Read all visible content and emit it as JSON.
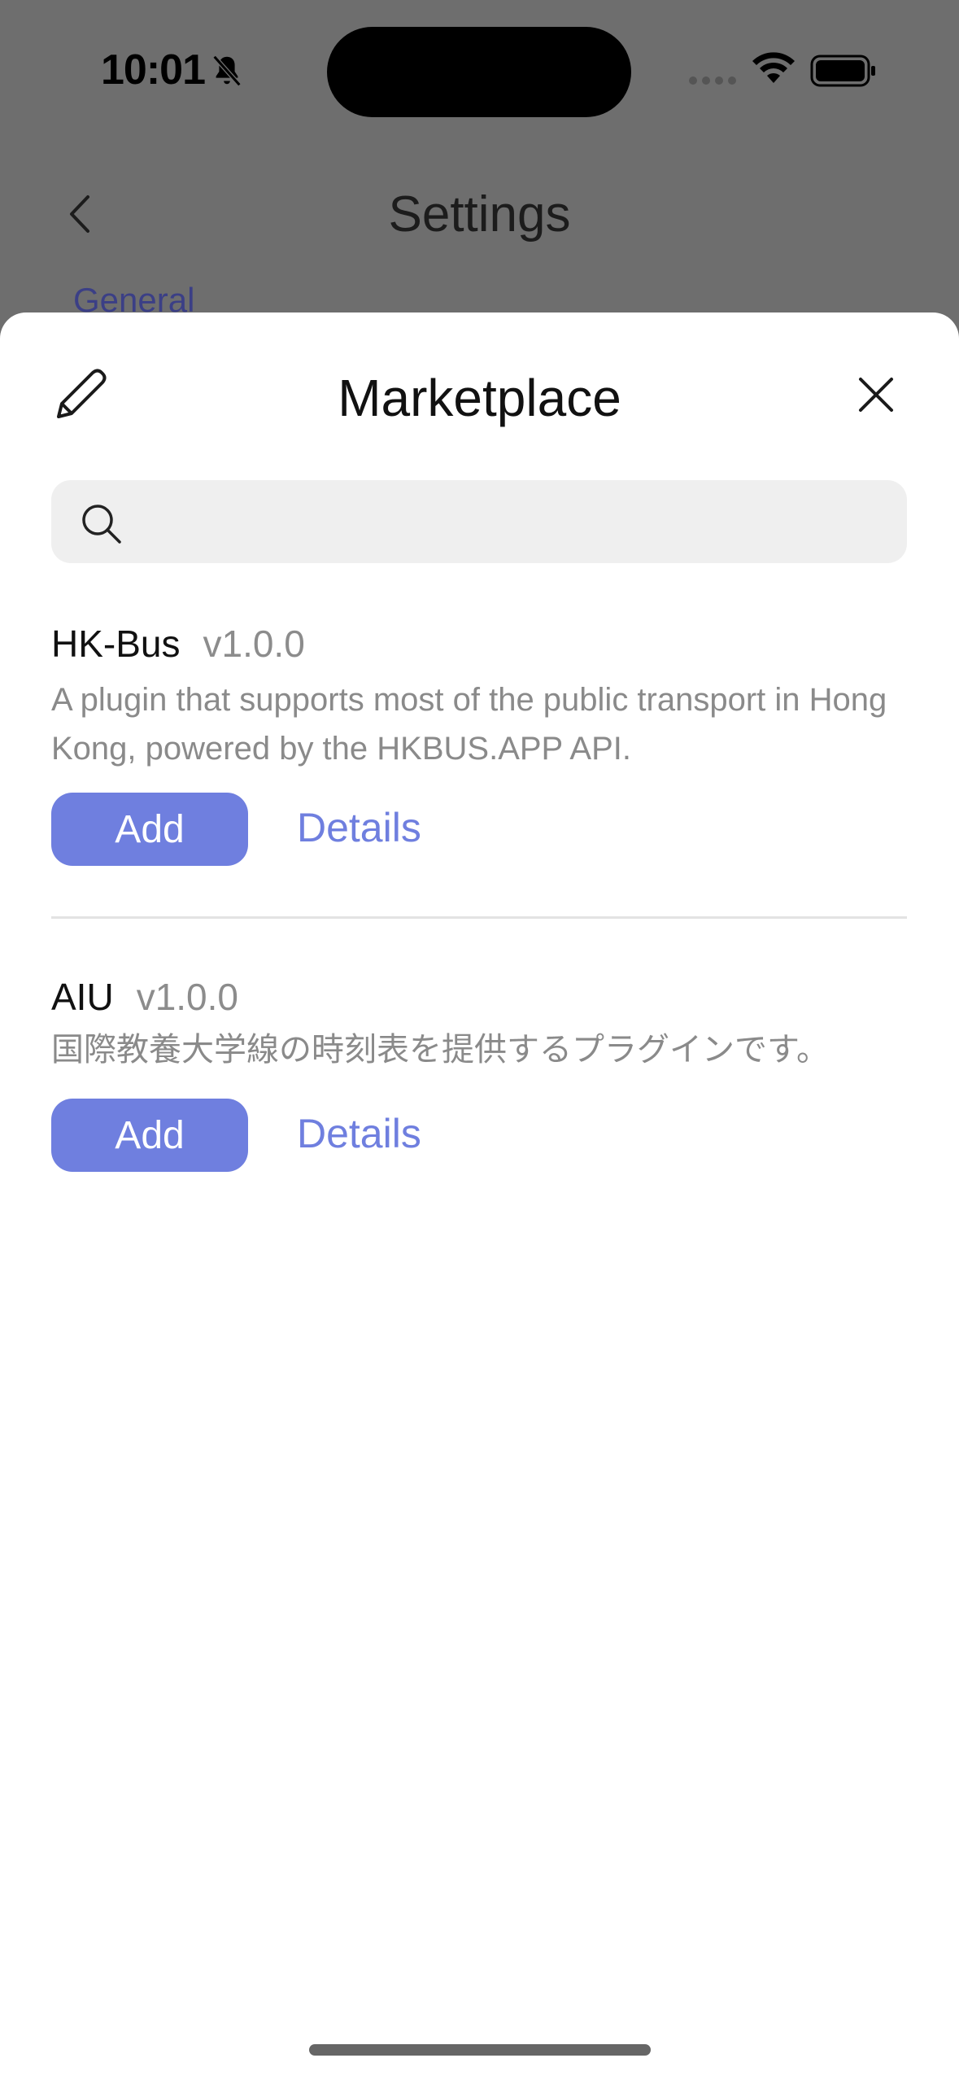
{
  "status_bar": {
    "time": "10:01",
    "icons": [
      "bell-off-icon",
      "signal-icon",
      "wifi-icon",
      "battery-icon"
    ]
  },
  "background_screen": {
    "title": "Settings",
    "section_label": "General"
  },
  "sheet": {
    "title": "Marketplace",
    "search": {
      "placeholder": "",
      "value": ""
    },
    "plugins": [
      {
        "name": "HK-Bus",
        "version": "v1.0.0",
        "description": "A plugin that supports most of the public transport in Hong Kong, powered by the HKBUS.APP API.",
        "add_label": "Add",
        "details_label": "Details"
      },
      {
        "name": "AIU",
        "version": "v1.0.0",
        "description": "国際教養大学線の時刻表を提供するプラグインです。",
        "add_label": "Add",
        "details_label": "Details"
      }
    ]
  },
  "colors": {
    "accent": "#6f7fdf",
    "overlay": "#6e6e6e",
    "secondary_text": "#8a8a8a",
    "search_bg": "#efefef"
  }
}
